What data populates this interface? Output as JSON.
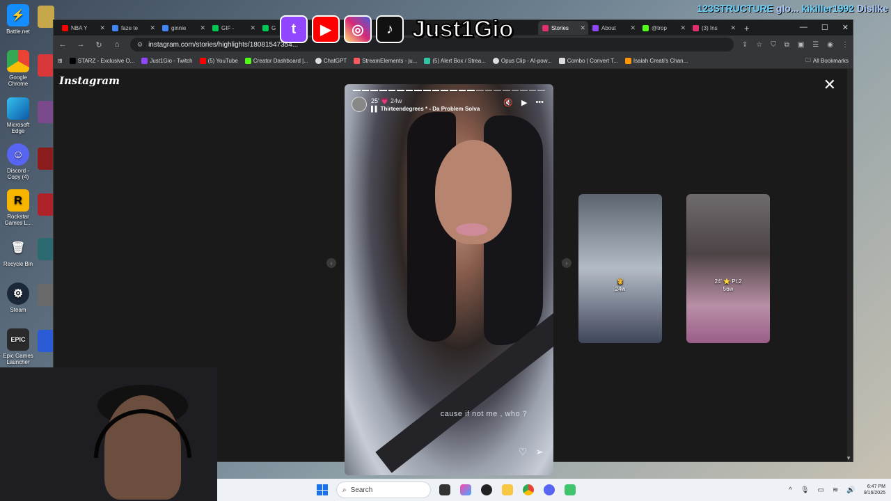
{
  "desktop_icons": [
    {
      "label": "Battle.net",
      "color": "#148eff"
    },
    {
      "label": "Google Chrome",
      "color": "#f4b400"
    },
    {
      "label": "Microsoft Edge",
      "color": "#1fa2e0"
    },
    {
      "label": "Discord - Copy (4)",
      "color": "#5865f2"
    },
    {
      "label": "Rockstar Games L...",
      "color": "#f7b500"
    },
    {
      "label": "Recycle Bin",
      "color": "#cfd8dc"
    },
    {
      "label": "Steam",
      "color": "#1b2838"
    },
    {
      "label": "Epic Games Launcher",
      "color": "#2a2a2a"
    }
  ],
  "browser": {
    "tabs": [
      {
        "label": "NBA Y",
        "color": "#ff0000"
      },
      {
        "label": "faze te",
        "color": "#4285f4"
      },
      {
        "label": "ginnie",
        "color": "#4285f4"
      },
      {
        "label": "GIF -",
        "color": "#00c853"
      },
      {
        "label": "G",
        "color": "#00c853"
      },
      {
        "label": "Stories",
        "color": "#e1306c",
        "active": true
      },
      {
        "label": "About",
        "color": "#9146ff"
      },
      {
        "label": "@trop",
        "color": "#53fc18"
      },
      {
        "label": "(3) Ins",
        "color": "#e1306c"
      }
    ],
    "url": "instagram.com/stories/highlights/18081547354...",
    "bookmarks": [
      {
        "label": "STARZ - Exclusive O...",
        "color": "#000000"
      },
      {
        "label": "Just1Gio - Twitch",
        "color": "#9146ff"
      },
      {
        "label": "(5) YouTube",
        "color": "#ff0000"
      },
      {
        "label": "Creator Dashboard |...",
        "color": "#53fc18"
      },
      {
        "label": "ChatGPT",
        "color": "#ffffff"
      },
      {
        "label": "StreamElements - ju...",
        "color": "#ff5a5f"
      },
      {
        "label": "(5) Alert Box / Strea...",
        "color": "#31c3a2"
      },
      {
        "label": "Opus Clip - AI-pow...",
        "color": "#ffffff"
      },
      {
        "label": "Combo | Convert T...",
        "color": "#ffffff"
      },
      {
        "label": "Isaiah Creati's Chan...",
        "color": "#ff9800"
      }
    ],
    "all_bookmarks": "All Bookmarks"
  },
  "instagram": {
    "logo": "Instagram",
    "story": {
      "user": "25'",
      "heart": "💗",
      "time": "24w",
      "music": "Thirteendegrees * - Da Problem Solva",
      "caption": "cause if not me , who ?",
      "progress_done": 14,
      "progress_total": 22
    },
    "cards": [
      {
        "icon": "👸",
        "time": "24w"
      },
      {
        "label": "24' ⭐ Pt.2",
        "time": "56w"
      }
    ]
  },
  "overlay": {
    "name": "Just1Gio",
    "badges": [
      {
        "name": "twitch-icon",
        "glyph": "t",
        "color": "#9146ff"
      },
      {
        "name": "youtube-icon",
        "glyph": "▶",
        "color": "#ff0000"
      },
      {
        "name": "instagram-icon",
        "glyph": "◎",
        "color": "#d6249f"
      },
      {
        "name": "tiktok-icon",
        "glyph": "♪",
        "color": "#111111"
      }
    ]
  },
  "chat": {
    "user": "123STRUCTURE",
    "msg": "glo...",
    "user2": "kikiller1992",
    "msg2": "Dislike"
  },
  "taskbar": {
    "search": "Search",
    "time": "6:47 PM",
    "date": "9/16/2025"
  }
}
